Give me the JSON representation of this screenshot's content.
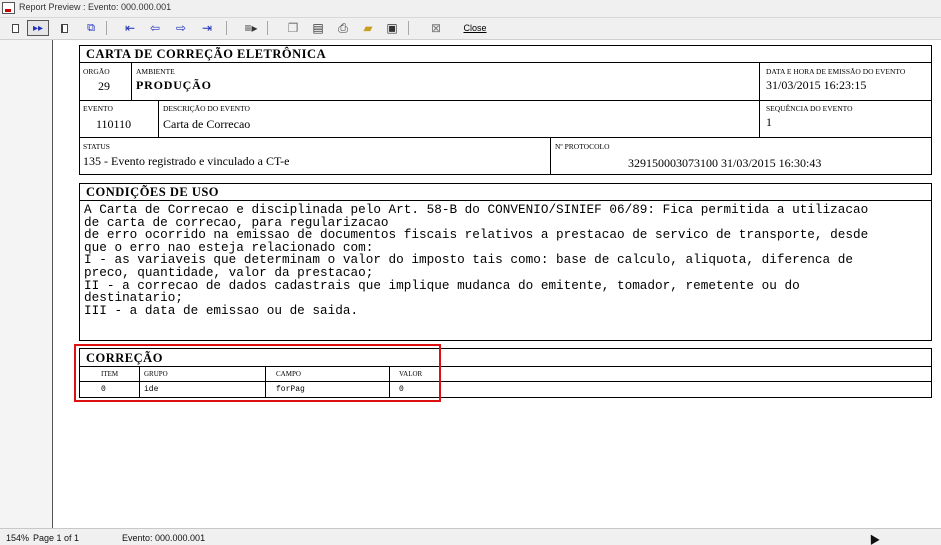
{
  "window": {
    "title": "Report Preview : Evento: 000.000.001"
  },
  "toolbar": {
    "close_label": "Close"
  },
  "report": {
    "title": "CARTA DE CORREÇÃO ELETRÔNICA",
    "orgao_label": "ORGÃO",
    "orgao_value": "29",
    "ambiente_label": "AMBIENTE",
    "ambiente_value": "PRODUÇÃO",
    "data_label": "DATA E HORA DE EMISSÃO DO EVENTO",
    "data_value": "31/03/2015 16:23:15",
    "evento_label": "EVENTO",
    "evento_value": "110110",
    "descricao_label": "DESCRIÇÃO DO EVENTO",
    "descricao_value": "Carta de Correcao",
    "sequencia_label": "SEQUÊNCIA DO EVENTO",
    "sequencia_value": "1",
    "status_label": "STATUS",
    "status_value": "135 - Evento registrado e vinculado a CT-e",
    "protocolo_label": "Nº PROTOCOLO",
    "protocolo_value": "329150003073100 31/03/2015 16:30:43",
    "condicoes_title": "CONDIÇÕES DE USO",
    "condicoes_lines": [
      "A Carta de Correcao e disciplinada pelo Art. 58-B do CONVENIO/SINIEF 06/89: Fica permitida a utilizacao",
      "de carta de correcao, para regularizacao",
      "de erro ocorrido na emissao de documentos fiscais relativos a prestacao de servico de transporte, desde",
      "que o erro nao esteja relacionado com:",
      "I - as variaveis que determinam o valor do imposto tais como: base de calculo, aliquota, diferenca de",
      "preco, quantidade, valor da prestacao;",
      "II - a correcao de dados cadastrais que implique mudanca do emitente, tomador, remetente ou do",
      "destinatario;",
      "III - a data de emissao ou de saida."
    ],
    "correcao_title": "CORREÇÃO",
    "correcao_columns": [
      "ITEM",
      "GRUPO",
      "CAMPO",
      "VALOR"
    ],
    "correcao_rows": [
      {
        "item": "0",
        "grupo": "ide",
        "campo": "forPag",
        "valor": "0"
      }
    ]
  },
  "status": {
    "zoom": "154%",
    "page": "Page 1 of 1",
    "evento": "Evento: 000.000.001"
  }
}
